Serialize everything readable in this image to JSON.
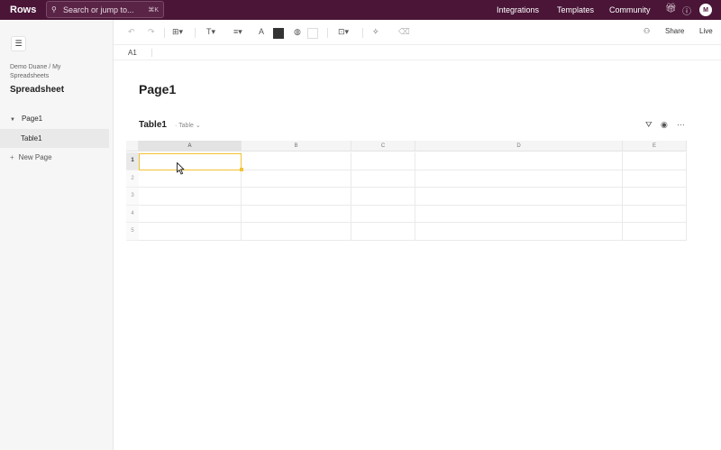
{
  "app": {
    "logo": "Rows",
    "search_placeholder": "Search or jump to...",
    "search_shortcut": "⌘K",
    "nav": [
      "Integrations",
      "Templates",
      "Community"
    ],
    "avatar_initial": "M",
    "brand_color": "#4a1537"
  },
  "sidebar": {
    "breadcrumb": "Demo Duane / My Spreadsheets",
    "title": "Spreadsheet",
    "page": "Page1",
    "table": "Table1",
    "new_page": "New Page"
  },
  "toolbar": {
    "share": "Share",
    "live": "Live"
  },
  "formula_bar": {
    "cell_ref": "A1"
  },
  "main": {
    "page_title": "Page1",
    "table_title": "Table1",
    "table_type": "Table"
  },
  "grid": {
    "columns": [
      "A",
      "B",
      "C",
      "D",
      "E"
    ],
    "rows": [
      "1",
      "2",
      "3",
      "4",
      "5"
    ],
    "selected_cell": "A1",
    "selection_color": "#f2c230"
  }
}
